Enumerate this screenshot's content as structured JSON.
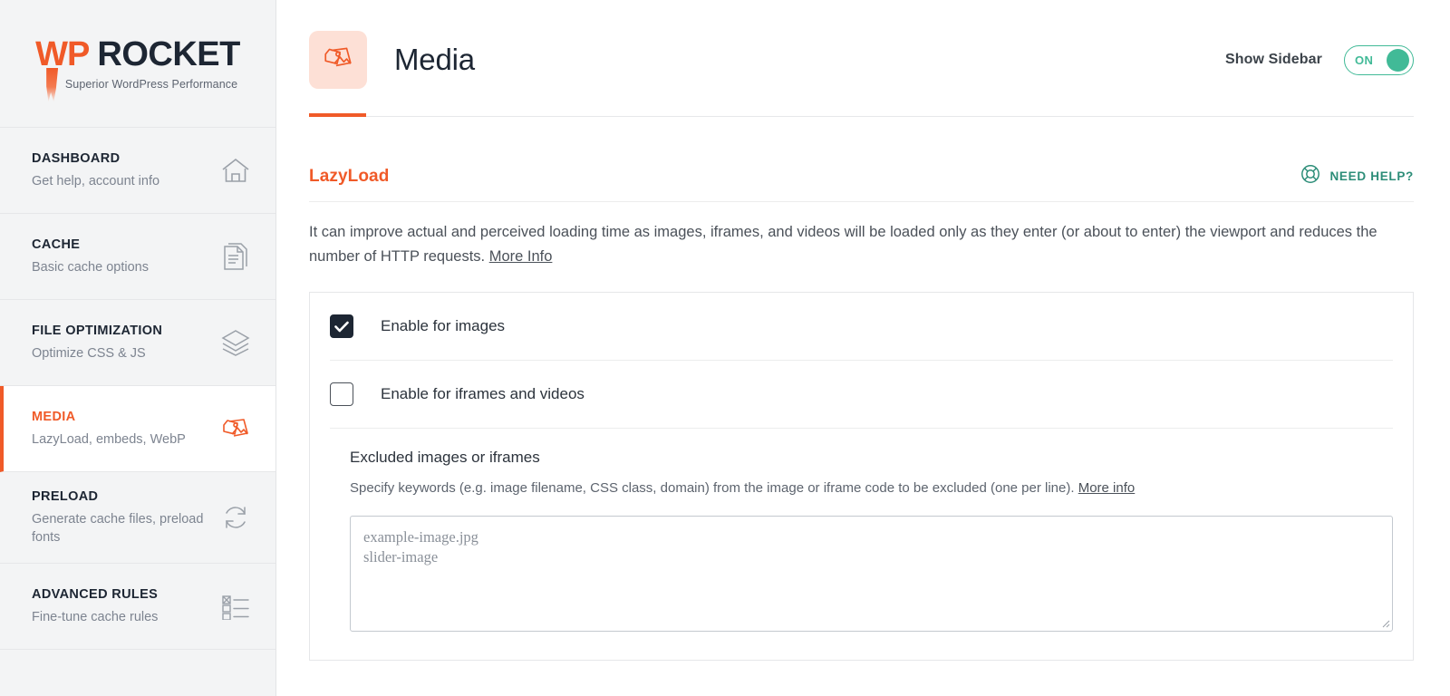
{
  "brand": {
    "logo_primary": "WP",
    "logo_secondary": "ROCKET",
    "tagline": "Superior WordPress Performance",
    "accent_color": "#f05a28",
    "dark_color": "#1d2633",
    "teal_color": "#41ba97"
  },
  "sidebar": {
    "items": [
      {
        "title": "DASHBOARD",
        "subtitle": "Get help, account info",
        "icon": "home-icon",
        "active": false
      },
      {
        "title": "CACHE",
        "subtitle": "Basic cache options",
        "icon": "document-icon",
        "active": false
      },
      {
        "title": "FILE OPTIMIZATION",
        "subtitle": "Optimize CSS & JS",
        "icon": "layers-icon",
        "active": false
      },
      {
        "title": "MEDIA",
        "subtitle": "LazyLoad, embeds, WebP",
        "icon": "media-icon",
        "active": true
      },
      {
        "title": "PRELOAD",
        "subtitle": "Generate cache files, preload fonts",
        "icon": "refresh-icon",
        "active": false
      },
      {
        "title": "ADVANCED RULES",
        "subtitle": "Fine-tune cache rules",
        "icon": "checklist-icon",
        "active": false
      }
    ]
  },
  "header": {
    "icon": "media-icon",
    "title": "Media",
    "show_sidebar_label": "Show Sidebar",
    "toggle_state": "ON"
  },
  "section": {
    "title": "LazyLoad",
    "need_help_label": "NEED HELP?",
    "need_help_icon": "lifebuoy-icon",
    "description": "It can improve actual and perceived loading time as images, iframes, and videos will be loaded only as they enter (or about to enter) the viewport and reduces the number of HTTP requests.",
    "description_link": "More Info"
  },
  "options": [
    {
      "label": "Enable for images",
      "checked": true
    },
    {
      "label": "Enable for iframes and videos",
      "checked": false
    }
  ],
  "excluded": {
    "title": "Excluded images or iframes",
    "description": "Specify keywords (e.g. image filename, CSS class, domain) from the image or iframe code to be excluded (one per line).",
    "description_link": "More info",
    "placeholder": "example-image.jpg\nslider-image",
    "value": ""
  }
}
